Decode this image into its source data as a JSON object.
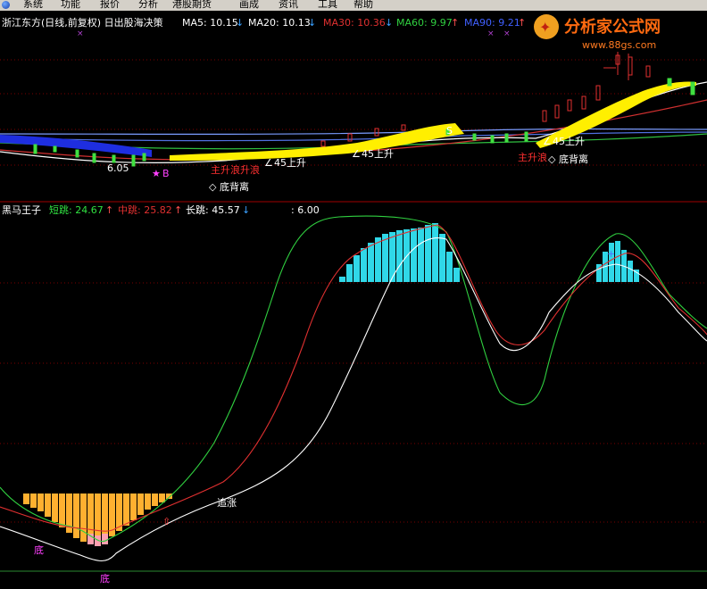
{
  "menu": [
    "系统",
    "功能",
    "报价",
    "分析",
    "港股期货",
    "画成",
    "资讯",
    "工具",
    "帮助"
  ],
  "upper": {
    "title": "浙江东方(日线,前复权) 日出股海决策",
    "ma5_label": "MA5: 10.15",
    "ma5_color": "#ffffff",
    "ma20_label": "MA20: 10.13",
    "ma20_color": "#ffffff",
    "ma30_label": "MA30: 10.36",
    "ma30_color": "#e03030",
    "ma60_label": "MA60: 9.97",
    "ma60_color": "#30d040",
    "ma90_label": "MA90: 9.21",
    "ma90_color": "#4060ff",
    "annotations": {
      "price_low": "6.05",
      "b_marker": "B",
      "main_wave_1": "主升浪升浪",
      "up45_1": "45上升",
      "up45_2": "45上升",
      "s_marker": "S",
      "up45_3": "45上升",
      "main_wave_2": "主升浪",
      "divergence_1": "底背离",
      "divergence_2": "底背离"
    }
  },
  "lower": {
    "title": "黑马王子",
    "short_label": "短跳: 24.67",
    "short_color": "#30e040",
    "mid_label": "中跳: 25.82",
    "mid_color": "#e03030",
    "long_label": "长跳: 45.57",
    "long_color": "#ffffff",
    "extra_label": ": 6.00",
    "annotations": {
      "chase": "追涨",
      "bottom_1": "底",
      "bottom_2": "底"
    }
  },
  "logo": {
    "text": "分析家公式网",
    "url": "www.88gs.com"
  }
}
